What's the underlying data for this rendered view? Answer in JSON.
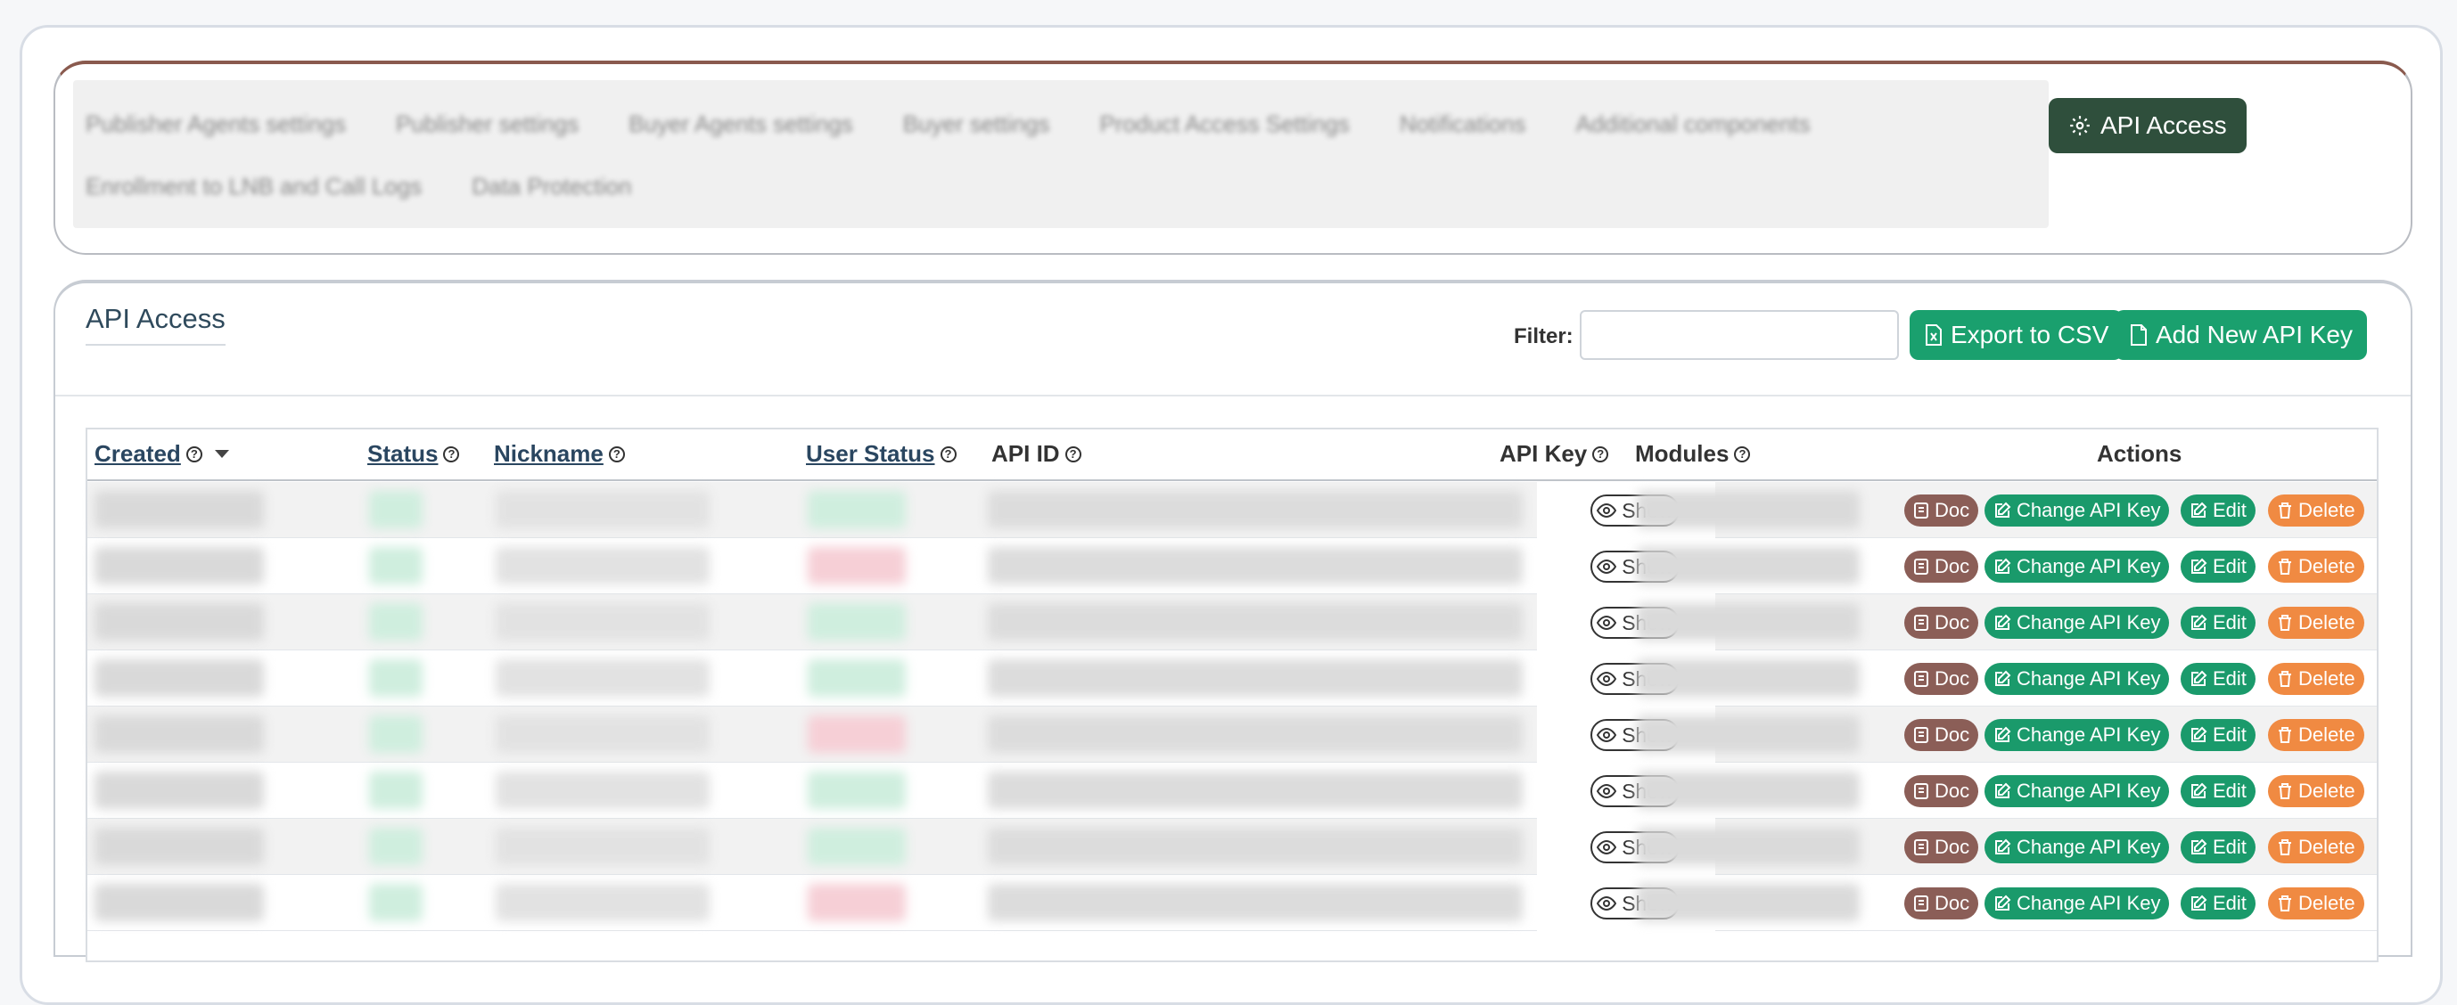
{
  "tabs": {
    "blurred_items_row1": [
      "Publisher Agents settings",
      "Publisher settings",
      "Buyer Agents settings",
      "Buyer settings",
      "Product Access Settings",
      "Notifications",
      "Additional components"
    ],
    "blurred_items_row2": [
      "Enrollment to LNB and Call Logs",
      "Data Protection"
    ],
    "active_label": "API Access"
  },
  "section": {
    "title": "API Access"
  },
  "toolbar": {
    "filter_label": "Filter:",
    "filter_value": "",
    "export_label": "Export to CSV",
    "add_label": "Add New API Key"
  },
  "table": {
    "headers": {
      "created": "Created",
      "status": "Status",
      "nickname": "Nickname",
      "user_status": "User Status",
      "api_id": "API ID",
      "api_key": "API Key",
      "modules": "Modules",
      "actions": "Actions"
    },
    "show_label": "Show",
    "actions": {
      "doc": "Doc",
      "change": "Change API Key",
      "edit": "Edit",
      "delete": "Delete"
    },
    "rows": [
      {
        "user_status_color": "#cfeede"
      },
      {
        "user_status_color": "#f6cfd6"
      },
      {
        "user_status_color": "#cfeede"
      },
      {
        "user_status_color": "#cfeede"
      },
      {
        "user_status_color": "#f6cfd6"
      },
      {
        "user_status_color": "#cfeede"
      },
      {
        "user_status_color": "#cfeede"
      },
      {
        "user_status_color": "#f6cfd6"
      }
    ]
  },
  "colors": {
    "active_tab": "#2f4f3c",
    "primary_green": "#1aa06e",
    "doc_brown": "#8b5e57",
    "delete_orange": "#f08a42"
  }
}
